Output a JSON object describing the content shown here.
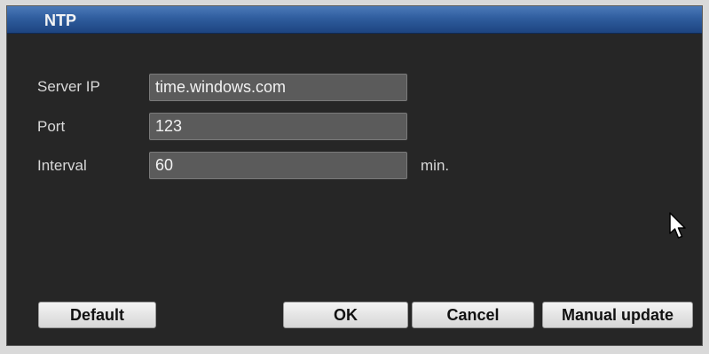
{
  "dialog": {
    "title": "NTP"
  },
  "form": {
    "server_ip": {
      "label": "Server IP",
      "value": "time.windows.com"
    },
    "port": {
      "label": "Port",
      "value": "123"
    },
    "interval": {
      "label": "Interval",
      "value": "60",
      "unit": "min."
    }
  },
  "buttons": {
    "default": "Default",
    "ok": "OK",
    "cancel": "Cancel",
    "manual_update": "Manual update"
  },
  "icons": {
    "cursor": "mouse-pointer-icon"
  },
  "colors": {
    "titlebar": "#2f5d9e",
    "background": "#262626",
    "field": "#5b5b5b",
    "button": "#e6e6e6"
  }
}
